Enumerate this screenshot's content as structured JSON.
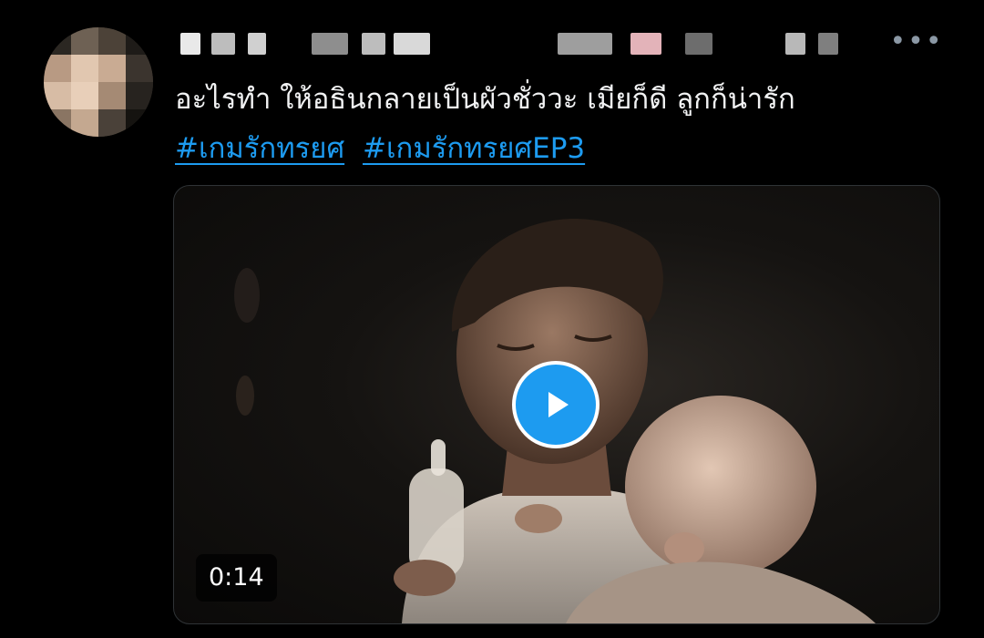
{
  "tweet": {
    "author_display_name_redacted": true,
    "more_label": "•••",
    "text": "อะไรทำ ให้อธินกลายเป็นผัวชั่ววะ เมียก็ดี ลูกก็น่ารัก",
    "hashtags": [
      "#เกมรักทรยศ",
      "#เกมรักทรยศEP3"
    ],
    "media": {
      "type": "video",
      "duration": "0:14"
    }
  },
  "colors": {
    "background": "#000000",
    "text": "#f1f2f3",
    "link": "#1d9bf0",
    "play_button": "#1d9bf0",
    "muted": "#8b98a5"
  },
  "icons": {
    "more": "more-horizontal-icon",
    "play": "play-icon"
  }
}
